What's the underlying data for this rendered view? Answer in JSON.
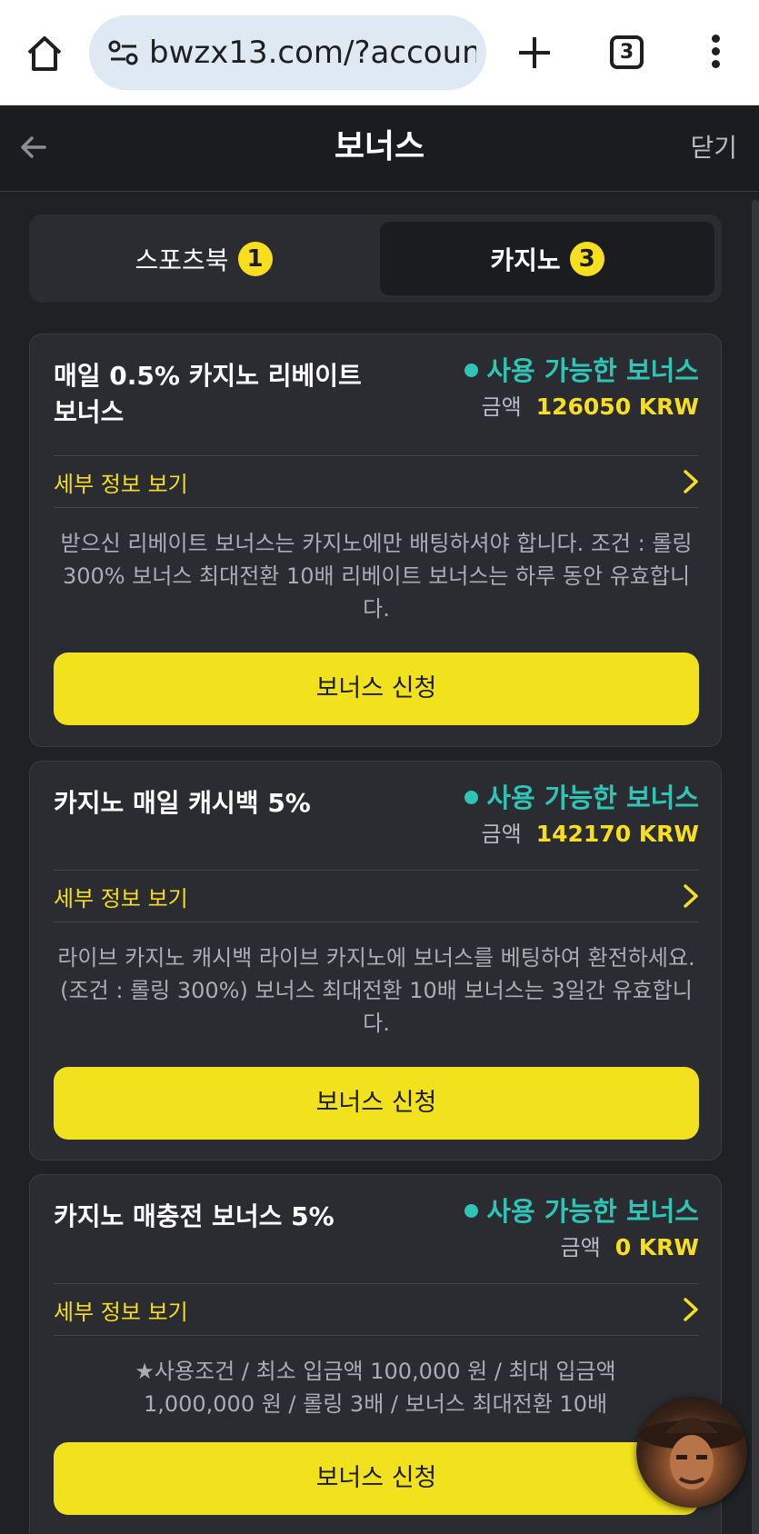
{
  "browser": {
    "url": "bwzx13.com/?account:",
    "tab_count": "3"
  },
  "header": {
    "title": "보너스",
    "close_label": "닫기"
  },
  "tabs": [
    {
      "label": "스포츠북",
      "count": "1",
      "active": false
    },
    {
      "label": "카지노",
      "count": "3",
      "active": true
    }
  ],
  "bonuses": [
    {
      "title": "매일 0.5% 카지노 리베이트 보너스",
      "status": "사용 가능한 보너스",
      "amount_label": "금액",
      "amount": "126050 KRW",
      "details_label": "세부 정보 보기",
      "description": "받으신 리베이트 보너스는 카지노에만 배팅하셔야 합니다. 조건 : 롤링 300% 보너스 최대전환 10배 리베이트 보너스는 하루 동안 유효합니다.",
      "button_label": "보너스 신청"
    },
    {
      "title": "카지노 매일 캐시백 5%",
      "status": "사용 가능한 보너스",
      "amount_label": "금액",
      "amount": "142170 KRW",
      "details_label": "세부 정보 보기",
      "description": "라이브 카지노 캐시백 라이브 카지노에 보너스를 베팅하여 환전하세요. (조건 : 롤링 300%) 보너스 최대전환 10배 보너스는 3일간 유효합니다.",
      "button_label": "보너스 신청"
    },
    {
      "title": "카지노 매충전 보너스 5%",
      "status": "사용 가능한 보너스",
      "amount_label": "금액",
      "amount": "0 KRW",
      "details_label": "세부 정보 보기",
      "description": "★사용조건 / 최소 입금액 100,000 원 / 최대 입금액 1,000,000 원 / 롤링 3배 / 보너스 최대전환 10배",
      "button_label": "보너스 신청"
    }
  ],
  "colors": {
    "accent_yellow": "#f7df1e",
    "status_teal": "#2ec4b6",
    "background": "#1f2125",
    "card": "#2a2c31"
  }
}
